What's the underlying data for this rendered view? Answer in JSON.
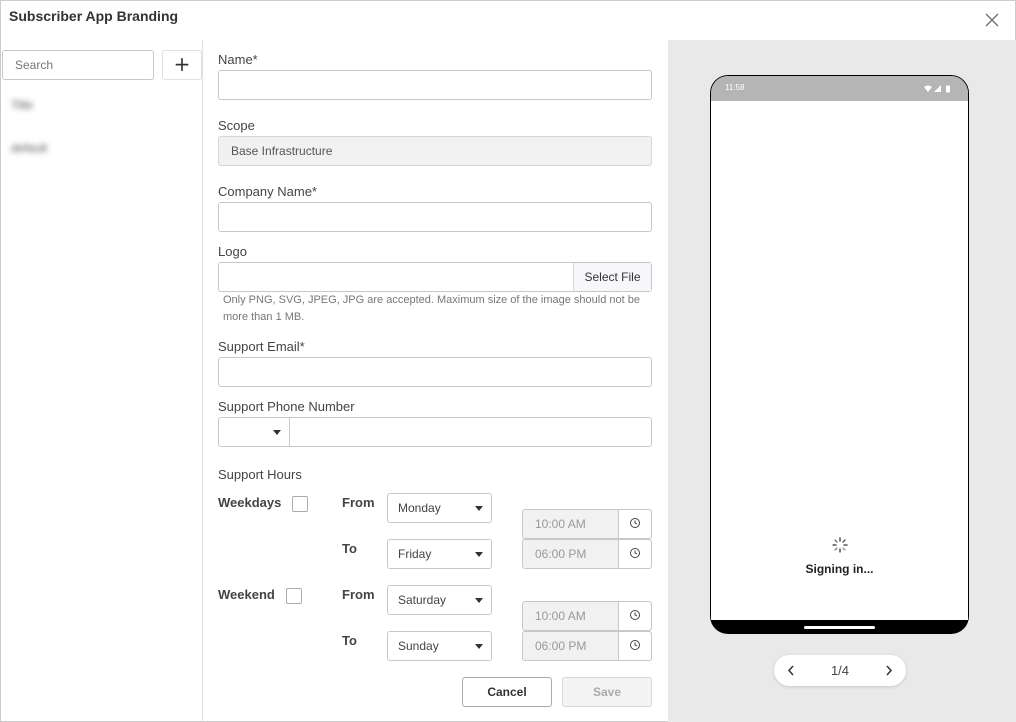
{
  "dialog": {
    "title": "Subscriber App Branding"
  },
  "sidebar": {
    "search_placeholder": "Search",
    "add_label": "+",
    "items": [
      {
        "label": "Title"
      },
      {
        "label": "default"
      }
    ]
  },
  "form": {
    "name_label": "Name*",
    "scope_label": "Scope",
    "scope_value": "Base Infrastructure",
    "company_label": "Company Name*",
    "logo_label": "Logo",
    "select_file_label": "Select File",
    "logo_hint": "Only PNG, SVG, JPEG, JPG are accepted. Maximum size of the image should not be more than 1 MB.",
    "email_label": "Support Email*",
    "phone_label": "Support Phone Number",
    "hours_label": "Support Hours",
    "weekdays_label": "Weekdays",
    "weekend_label": "Weekend",
    "from_label": "From",
    "to_label": "To",
    "weekdays": {
      "from_day": "Monday",
      "to_day": "Friday",
      "from_time": "10:00 AM",
      "to_time": "06:00 PM"
    },
    "weekend": {
      "from_day": "Saturday",
      "to_day": "Sunday",
      "from_time": "10:00 AM",
      "to_time": "06:00 PM"
    },
    "cancel_label": "Cancel",
    "save_label": "Save"
  },
  "preview": {
    "status_time": "11:58",
    "message": "Signing in...",
    "pager": "1/4"
  }
}
